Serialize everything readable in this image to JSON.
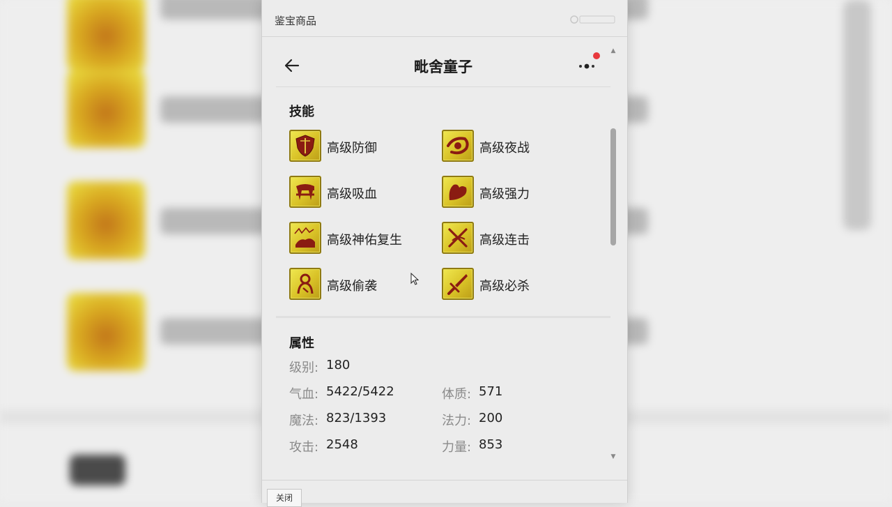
{
  "window": {
    "title": "鉴宝商品",
    "close_label": "关闭"
  },
  "header": {
    "title": "毗舍童子"
  },
  "skills": {
    "title": "技能",
    "items": [
      {
        "label": "高级防御",
        "icon": "shield-icon"
      },
      {
        "label": "高级夜战",
        "icon": "eye-icon"
      },
      {
        "label": "高级吸血",
        "icon": "fang-icon"
      },
      {
        "label": "高级强力",
        "icon": "muscle-icon"
      },
      {
        "label": "高级神佑复生",
        "icon": "revive-icon"
      },
      {
        "label": "高级连击",
        "icon": "crossed-swords-icon"
      },
      {
        "label": "高级偷袭",
        "icon": "sneak-icon"
      },
      {
        "label": "高级必杀",
        "icon": "sword-icon"
      }
    ]
  },
  "attributes": {
    "title": "属性",
    "items": [
      {
        "key": "级别:",
        "value": "180"
      },
      {
        "key": "气血:",
        "value": "5422/5422"
      },
      {
        "key": "体质:",
        "value": "571"
      },
      {
        "key": "魔法:",
        "value": "823/1393"
      },
      {
        "key": "法力:",
        "value": "200"
      },
      {
        "key": "攻击:",
        "value": "2548"
      },
      {
        "key": "力量:",
        "value": "853"
      }
    ]
  },
  "colors": {
    "accent_red": "#e8383d",
    "icon_gold": "#d9c227",
    "icon_maroon": "#8a1c12"
  }
}
